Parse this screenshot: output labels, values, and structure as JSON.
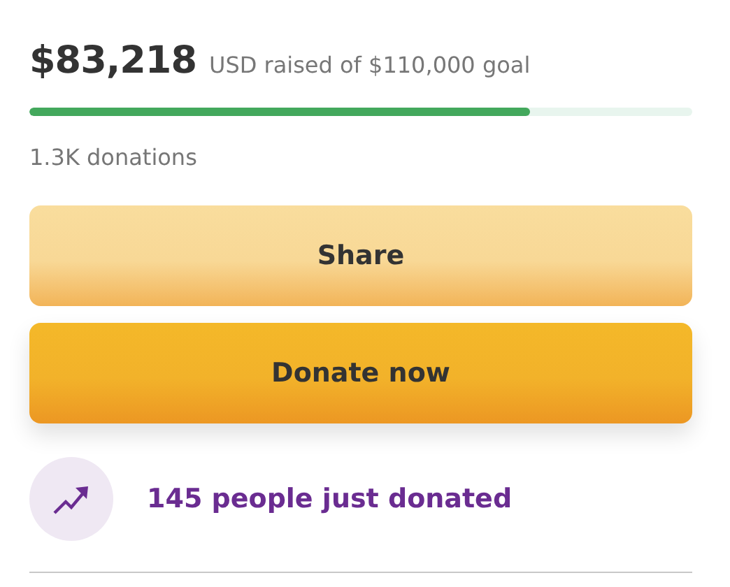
{
  "amount": "$83,218",
  "goal_text": "USD raised of $110,000 goal",
  "progress": {
    "level": 0.755
  },
  "donations": "1.3K donations",
  "buttons": [
    {
      "label": "Share",
      "kind": "secondary"
    },
    {
      "label": "Donate now",
      "kind": "primary"
    }
  ],
  "activity": {
    "text": "145 people just donated"
  }
}
